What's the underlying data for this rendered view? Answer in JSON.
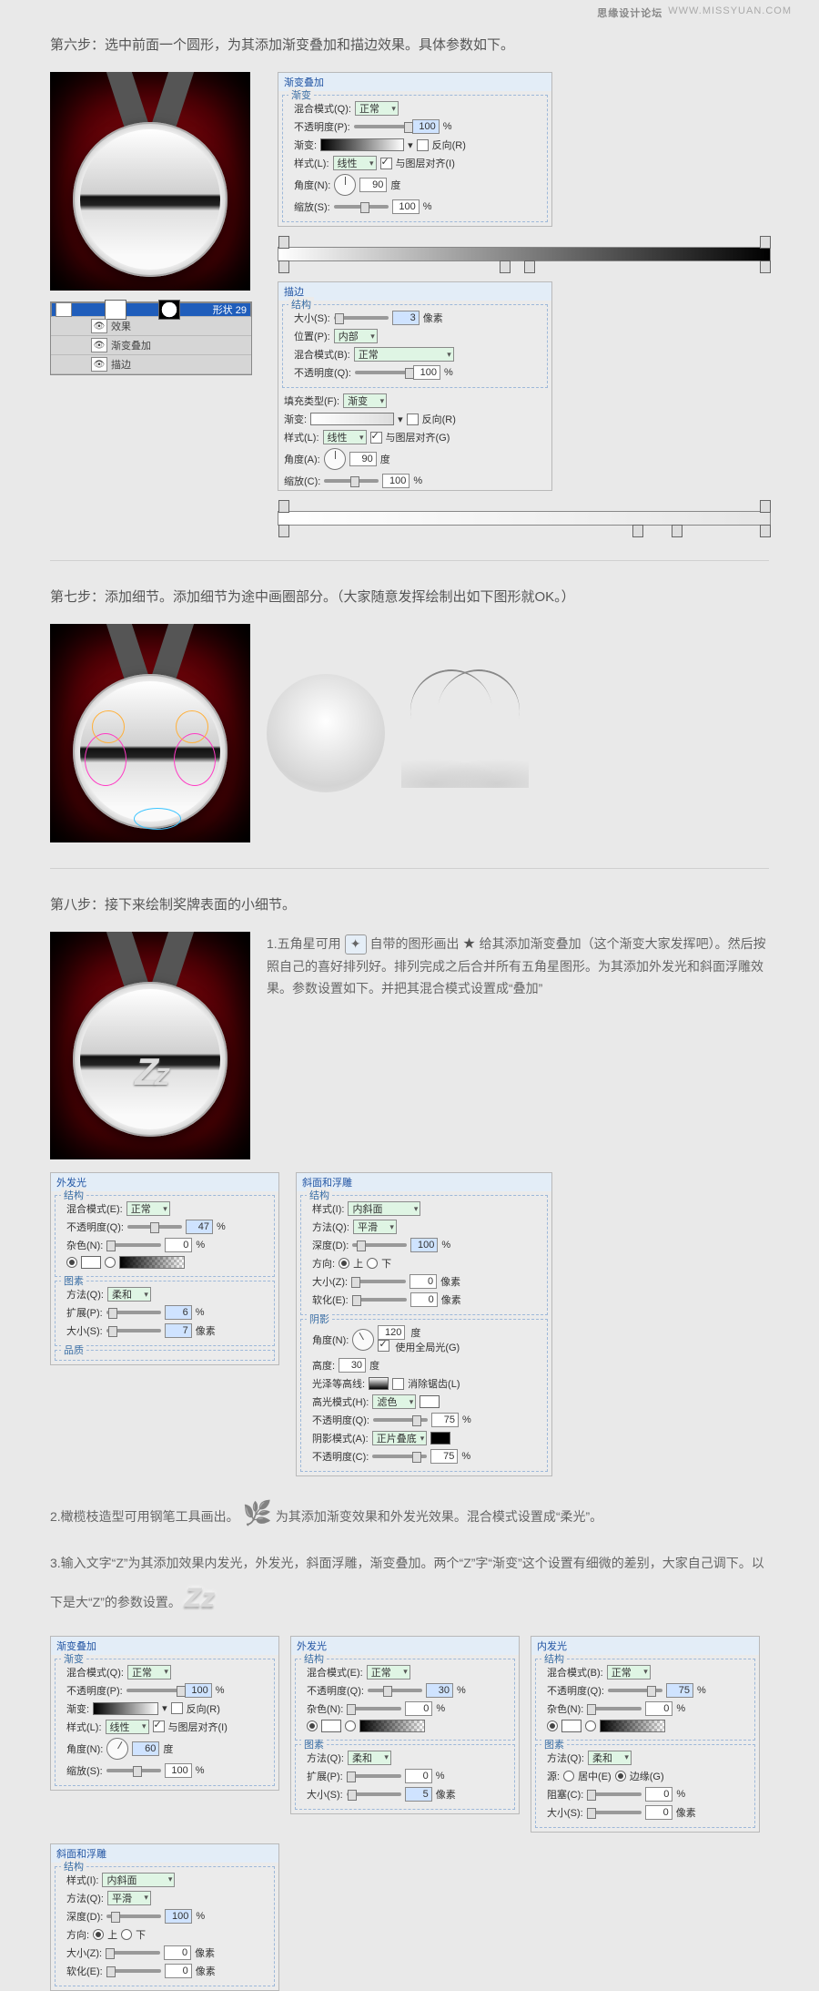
{
  "watermark": {
    "cn": "思缘设计论坛",
    "url": "WWW.MISSYUAN.COM"
  },
  "step6": {
    "title": "第六步：选中前面一个圆形，为其添加渐变叠加和描边效果。具体参数如下。",
    "layers": {
      "shapeName": "形状 29",
      "fxTitle": "效果",
      "fxGrad": "渐变叠加",
      "fxStroke": "描边"
    },
    "gradOverlay": {
      "panelTitle": "渐变叠加",
      "section": "渐变",
      "blendLabel": "混合模式(Q):",
      "blend": "正常",
      "opacityLabel": "不透明度(P):",
      "opacity": "100",
      "pct": "%",
      "gradLabel": "渐变:",
      "reverse": "反向(R)",
      "styleLabel": "样式(L):",
      "style": "线性",
      "align": "与图层对齐(I)",
      "angleLabel": "角度(N):",
      "angle": "90",
      "deg": "度",
      "scaleLabel": "缩放(S):",
      "scale": "100"
    },
    "stroke": {
      "panelTitle": "描边",
      "section": "结构",
      "sizeLabel": "大小(S):",
      "size": "3",
      "px": "像素",
      "posLabel": "位置(P):",
      "pos": "内部",
      "blendLabel": "混合模式(B):",
      "blend": "正常",
      "opacityLabel": "不透明度(Q):",
      "opacity": "100",
      "pct": "%",
      "fillLabel": "填充类型(F):",
      "fill": "渐变",
      "gradLabel": "渐变:",
      "reverse": "反向(R)",
      "styleLabel": "样式(L):",
      "style": "线性",
      "align": "与图层对齐(G)",
      "angleLabel": "角度(A):",
      "angle": "90",
      "deg": "度",
      "scaleLabel": "缩放(C):",
      "scale": "100"
    }
  },
  "step7": {
    "title": "第七步：添加细节。添加细节为途中画圈部分。（大家随意发挥绘制出如下图形就OK。）"
  },
  "step8": {
    "title": "第八步：接下来绘制奖牌表面的小细节。",
    "p1_a": "1.五角星可用",
    "p1_b": "自带的图形画出",
    "p1_c": "给其添加渐变叠加（这个渐变大家发挥吧）。然后按照自己的喜好排列好。排列完成之后合并所有五角星图形。为其添加外发光和斜面浮雕效果。参数设置如下。并把其混合模式设置成“叠加”",
    "p2_a": "2.橄榄枝造型可用钢笔工具画出。",
    "p2_b": "为其添加渐变效果和外发光效果。混合模式设置成“柔光”。",
    "p3": "3.输入文字“Z”为其添加效果内发光，外发光，斜面浮雕，渐变叠加。两个“Z”字“渐变”这个设置有细微的差别，大家自己调下。以下是大“Z”的参数设置。"
  },
  "outerGlow": {
    "panelTitle": "外发光",
    "sStruct": "结构",
    "blendLabel": "混合模式(E):",
    "blend": "正常",
    "opacityLabel": "不透明度(Q):",
    "opacity1": "47",
    "opacity2": "30",
    "pct": "%",
    "noiseLabel": "杂色(N):",
    "noise": "0",
    "sElem": "图素",
    "quality": "品质",
    "techLabel": "方法(Q):",
    "tech": "柔和",
    "spreadLabel": "扩展(P):",
    "spread1": "6",
    "spread2": "0",
    "sizeLabel": "大小(S):",
    "size1": "7",
    "size2": "5",
    "px": "像素"
  },
  "bevel": {
    "panelTitle": "斜面和浮雕",
    "sStruct": "结构",
    "styleLabel": "样式(I):",
    "style": "内斜面",
    "techLabel": "方法(Q):",
    "tech": "平滑",
    "depthLabel": "深度(D):",
    "depth": "100",
    "pct": "%",
    "dirLabel": "方向:",
    "up": "上",
    "down": "下",
    "sizeLabel": "大小(Z):",
    "size": "0",
    "px": "像素",
    "softLabel": "软化(E):",
    "soft": "0",
    "sShadow": "阴影",
    "angleLabel": "角度(N):",
    "angle": "120",
    "deg": "度",
    "globalLabel": "使用全局光(G)",
    "altLabel": "高度:",
    "alt": "30",
    "glossLabel": "光泽等高线:",
    "antiAlias": "消除锯齿(L)",
    "hiLabel": "高光模式(H):",
    "hi": "滤色",
    "hiOpLabel": "不透明度(Q):",
    "hiOp": "75",
    "shLabel": "阴影模式(A):",
    "sh": "正片叠底",
    "shOpLabel": "不透明度(C):",
    "shOp": "75"
  },
  "gradOverlay2": {
    "panelTitle": "渐变叠加",
    "section": "渐变",
    "blendLabel": "混合模式(Q):",
    "blend": "正常",
    "opacityLabel": "不透明度(P):",
    "opacity": "100",
    "pct": "%",
    "gradLabel": "渐变:",
    "reverse": "反向(R)",
    "styleLabel": "样式(L):",
    "style": "线性",
    "align": "与图层对齐(I)",
    "angleLabel": "角度(N):",
    "angle": "60",
    "deg": "度",
    "scaleLabel": "缩放(S):",
    "scale": "100"
  },
  "innerGlow": {
    "panelTitle": "内发光",
    "sStruct": "结构",
    "blendLabel": "混合模式(B):",
    "blend": "正常",
    "opacityLabel": "不透明度(Q):",
    "opacity": "75",
    "pct": "%",
    "noiseLabel": "杂色(N):",
    "noise": "0",
    "sElem": "图素",
    "techLabel": "方法(Q):",
    "tech": "柔和",
    "srcLabel": "源:",
    "center": "居中(E)",
    "edge": "边缘(G)",
    "chokeLabel": "阻塞(C):",
    "choke": "0",
    "sizeLabel": "大小(S):",
    "size": "0",
    "px": "像素"
  }
}
